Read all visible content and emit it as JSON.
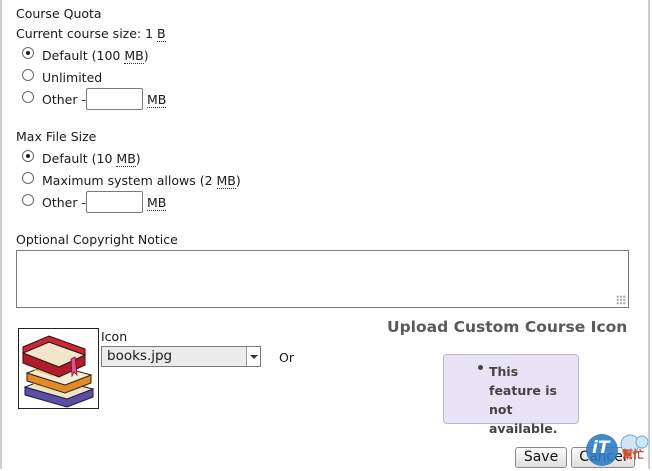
{
  "course_quota": {
    "heading": "Course Quota",
    "current_size_label": "Current course size: 1",
    "current_size_unit": "B",
    "options": [
      {
        "label_prefix": "Default (100 ",
        "unit": "MB",
        "label_suffix": ")",
        "checked": true
      },
      {
        "label": "Unlimited",
        "checked": false
      },
      {
        "label": "Other -",
        "value": "",
        "unit": "MB",
        "checked": false
      }
    ]
  },
  "max_file_size": {
    "heading": "Max File Size",
    "options": [
      {
        "label_prefix": "Default (10 ",
        "unit": "MB",
        "label_suffix": ")",
        "checked": true
      },
      {
        "label_prefix": "Maximum system allows (2 ",
        "unit": "MB",
        "label_suffix": ")",
        "checked": false
      },
      {
        "label": "Other -",
        "value": "",
        "unit": "MB",
        "checked": false
      }
    ]
  },
  "copyright": {
    "label": "Optional Copyright Notice",
    "value": ""
  },
  "icon_section": {
    "icon_label": "Icon",
    "selected_icon": "books.jpg",
    "or_label": "Or",
    "upload_title": "Upload Custom Course Icon",
    "unavailable_notice": "This feature is not available."
  },
  "buttons": {
    "save": "Save",
    "cancel": "Cancel"
  },
  "watermark": {
    "logo_text": "iT",
    "logo_subtext": "幫忙"
  }
}
